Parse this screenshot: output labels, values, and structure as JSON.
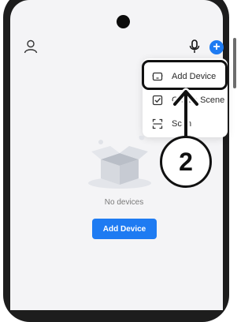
{
  "header": {
    "user_icon": "user-icon",
    "mic_icon": "microphone-icon",
    "plus_label": "+"
  },
  "menu": {
    "items": [
      {
        "label": "Add Device",
        "icon": "device-icon"
      },
      {
        "label": "Create Scene",
        "icon": "scene-check-icon"
      },
      {
        "label": "Scan",
        "icon": "scan-icon"
      }
    ]
  },
  "annotation": {
    "step_number": "2"
  },
  "empty_state": {
    "message": "No devices",
    "button_label": "Add Device"
  },
  "colors": {
    "accent": "#1e7bf2",
    "screen_bg": "#f4f4f6",
    "annotation": "#111111"
  }
}
